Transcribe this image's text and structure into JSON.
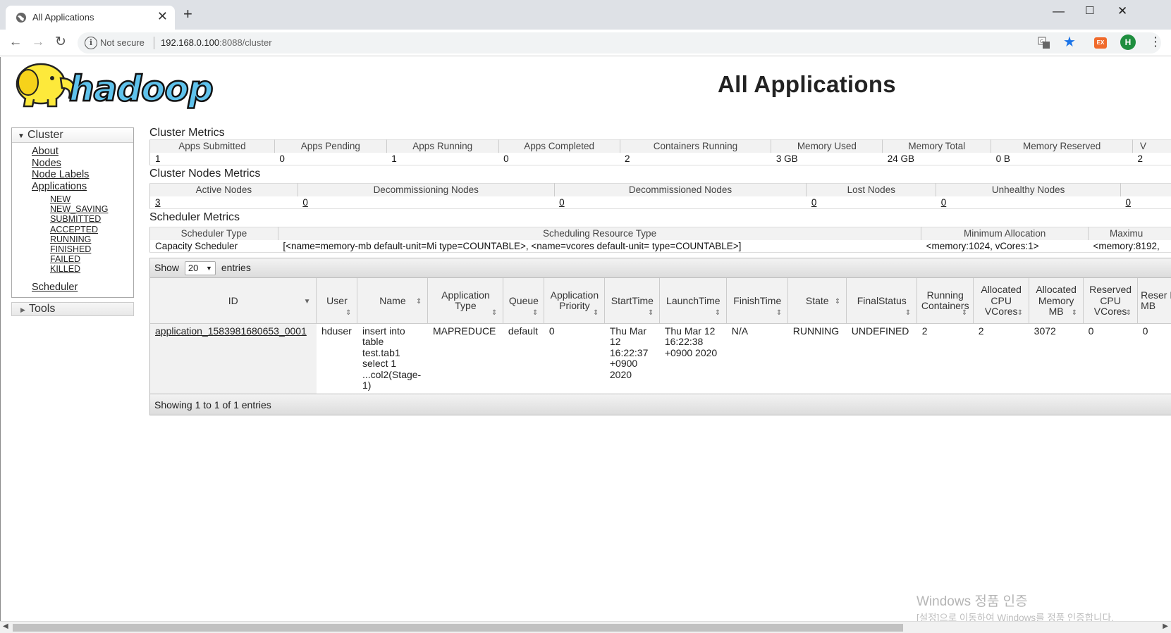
{
  "browser": {
    "tab_title": "All Applications",
    "tab_close": "✕",
    "new_tab": "+",
    "not_secure": "Not secure",
    "url_host": "192.168.0.100",
    "url_path": ":8088/cluster",
    "profile_initial": "H",
    "ext_label": "EX"
  },
  "page": {
    "title": "All Applications"
  },
  "nav": {
    "cluster_label": "Cluster",
    "links": [
      "About",
      "Nodes",
      "Node Labels",
      "Applications"
    ],
    "app_states": [
      "NEW",
      "NEW_SAVING",
      "SUBMITTED",
      "ACCEPTED",
      "RUNNING",
      "FINISHED",
      "FAILED",
      "KILLED"
    ],
    "scheduler": "Scheduler",
    "tools": "Tools"
  },
  "cluster_metrics": {
    "title": "Cluster Metrics",
    "headers": [
      "Apps Submitted",
      "Apps Pending",
      "Apps Running",
      "Apps Completed",
      "Containers Running",
      "Memory Used",
      "Memory Total",
      "Memory Reserved",
      "V"
    ],
    "values": [
      "1",
      "0",
      "1",
      "0",
      "2",
      "3 GB",
      "24 GB",
      "0 B",
      "2"
    ]
  },
  "node_metrics": {
    "title": "Cluster Nodes Metrics",
    "headers": [
      "Active Nodes",
      "Decommissioning Nodes",
      "Decommissioned Nodes",
      "Lost Nodes",
      "Unhealthy Nodes",
      ""
    ],
    "values": [
      "3",
      "0",
      "0",
      "0",
      "0",
      "0"
    ]
  },
  "scheduler_metrics": {
    "title": "Scheduler Metrics",
    "headers": [
      "Scheduler Type",
      "Scheduling Resource Type",
      "Minimum Allocation",
      "Maximu"
    ],
    "values": [
      "Capacity Scheduler",
      "[<name=memory-mb default-unit=Mi type=COUNTABLE>, <name=vcores default-unit= type=COUNTABLE>]",
      "<memory:1024, vCores:1>",
      "<memory:8192,"
    ]
  },
  "apps": {
    "show_label": "Show",
    "entries_label": "entries",
    "page_length": "20",
    "columns": [
      "ID",
      "User",
      "Name",
      "Application Type",
      "Queue",
      "Application Priority",
      "StartTime",
      "LaunchTime",
      "FinishTime",
      "State",
      "FinalStatus",
      "Running Containers",
      "Allocated CPU VCores",
      "Allocated Memory MB",
      "Reserved CPU VCores",
      "Reser Mem MB"
    ],
    "rows": [
      [
        "application_1583981680653_0001",
        "hduser",
        "insert into table test.tab1 select 1 ...col2(Stage-1)",
        "MAPREDUCE",
        "default",
        "0",
        "Thu Mar 12 16:22:37 +0900 2020",
        "Thu Mar 12 16:22:38 +0900 2020",
        "N/A",
        "RUNNING",
        "UNDEFINED",
        "2",
        "2",
        "3072",
        "0",
        "0"
      ]
    ],
    "footer": "Showing 1 to 1 of 1 entries"
  },
  "watermark": {
    "line1": "Windows 정품 인증",
    "line2": "[설정]으로 이동하여 Windows를 정품 인증합니다."
  },
  "colors": {
    "omnibox_bg": "#f1f3f4",
    "tabstrip_bg": "#dee1e6",
    "star": "#1a73e8",
    "profile": "#1e8e3e",
    "logo_yellow": "#fde93b",
    "logo_blue": "#5fc2ec"
  }
}
